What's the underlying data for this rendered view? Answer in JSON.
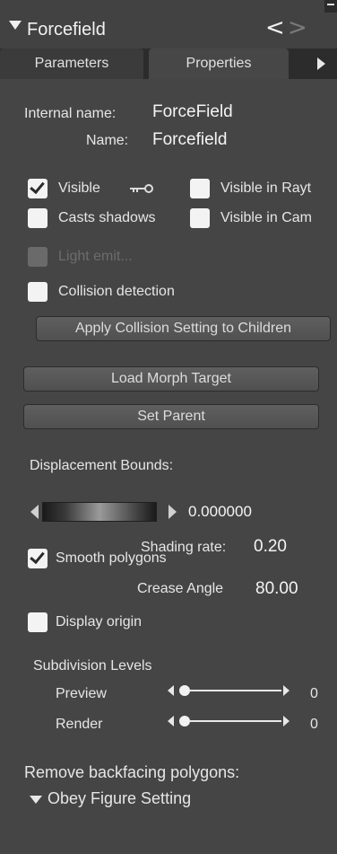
{
  "panel": {
    "title": "Forcefield"
  },
  "tabs": [
    {
      "label": "Parameters"
    },
    {
      "label": "Properties"
    }
  ],
  "identity": {
    "internal_name_label": "Internal name:",
    "internal_name_value": "ForceField",
    "name_label": "Name:",
    "name_value": "Forcefield"
  },
  "checkboxes": {
    "visible": {
      "label": "Visible",
      "checked": true
    },
    "visible_in_raytrace": {
      "label": "Visible in Rayt",
      "checked": false
    },
    "casts_shadows": {
      "label": "Casts shadows",
      "checked": false
    },
    "visible_in_camera": {
      "label": "Visible in Cam",
      "checked": false
    },
    "light_emitter": {
      "label": "Light emit...",
      "checked": false,
      "disabled": true
    },
    "collision_detection": {
      "label": "Collision detection",
      "checked": false
    },
    "smooth_polygons": {
      "label": "Smooth polygons",
      "checked": true
    },
    "display_origin": {
      "label": "Display origin",
      "checked": false
    }
  },
  "buttons": {
    "apply_collision": "Apply Collision Setting to Children",
    "load_morph": "Load Morph Target",
    "set_parent": "Set Parent"
  },
  "displacement": {
    "label": "Displacement Bounds:",
    "value": "0.000000"
  },
  "shading": {
    "label": "Shading rate:",
    "value": "0.20"
  },
  "crease": {
    "label": "Crease Angle",
    "value": "80.00"
  },
  "subdivision": {
    "label": "Subdivision Levels",
    "preview": {
      "label": "Preview",
      "value": "0"
    },
    "render": {
      "label": "Render",
      "value": "0"
    }
  },
  "backfacing": {
    "label": "Remove backfacing polygons:",
    "selected": "Obey Figure Setting"
  },
  "icons": {
    "title_arrow": "triangle-down-icon",
    "nav_back": "chevron-left-icon",
    "nav_forward": "chevron-right-icon",
    "key": "key-icon"
  },
  "colors": {
    "panel_bg": "#454545",
    "tab_bar": "#2c2c2c",
    "button": "#585858"
  }
}
